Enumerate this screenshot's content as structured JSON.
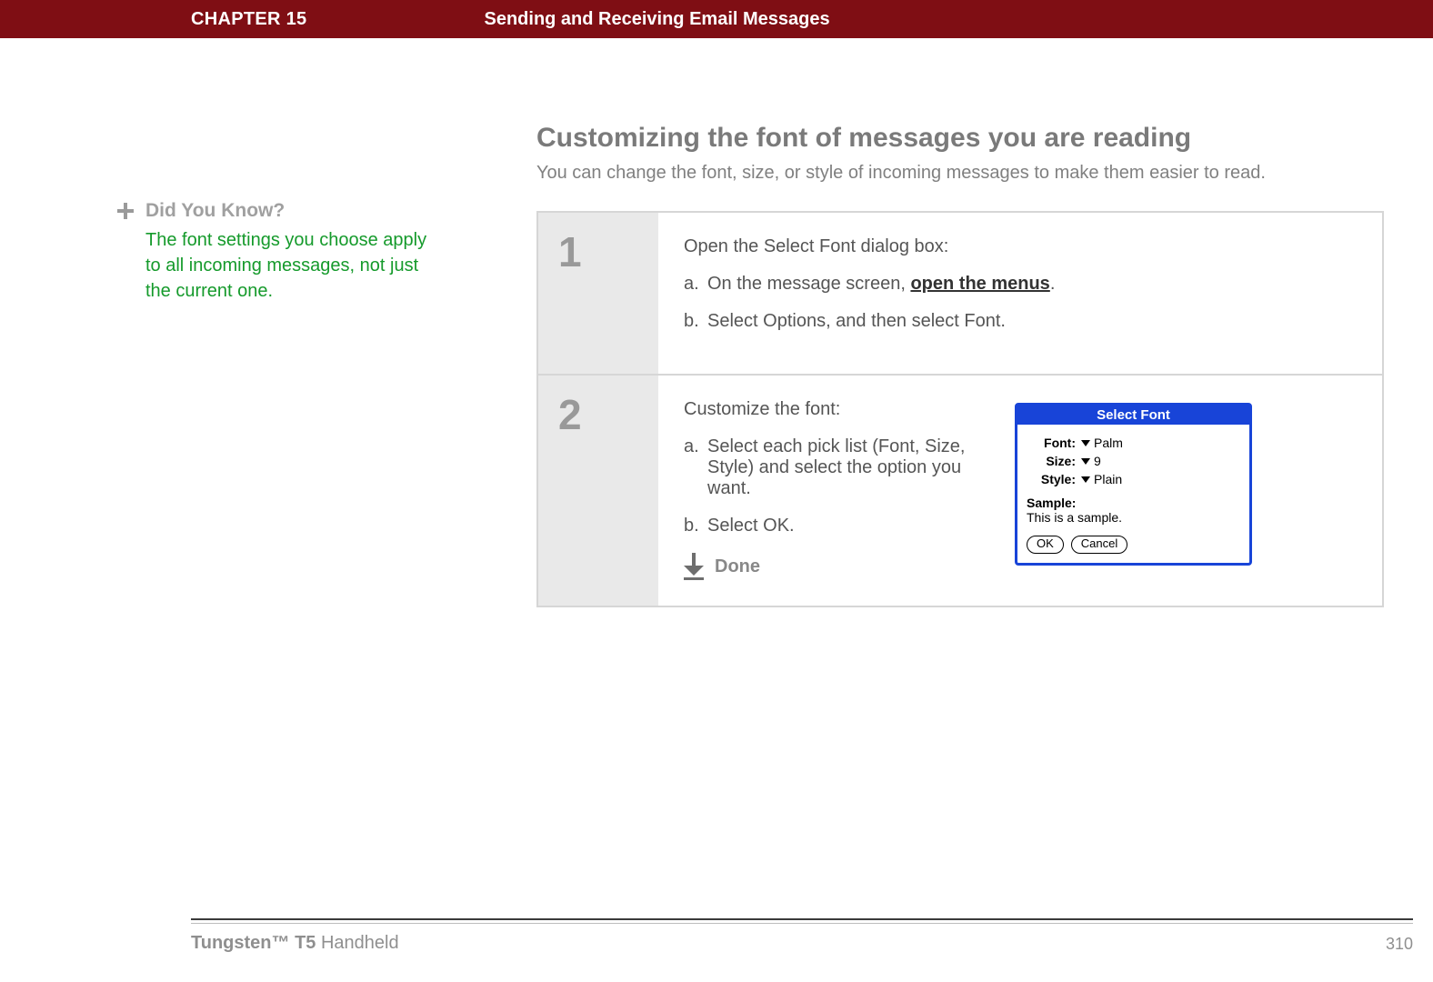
{
  "header": {
    "chapter": "CHAPTER 15",
    "title": "Sending and Receiving Email Messages"
  },
  "sidebar": {
    "did_you_know_label": "Did You Know?",
    "did_you_know_text": "The font settings you choose apply to all incoming messages, not just the current one."
  },
  "section": {
    "title": "Customizing the font of messages you are reading",
    "subtitle": "You can change the font, size, or style of incoming messages to make them easier to read."
  },
  "steps": [
    {
      "num": "1",
      "lead": "Open the Select Font dialog box:",
      "a_letter": "a.",
      "a_pre": "On the message screen, ",
      "a_link": "open the menus",
      "a_post": ".",
      "b_letter": "b.",
      "b_text": "Select Options, and then select Font."
    },
    {
      "num": "2",
      "lead": "Customize the font:",
      "a_letter": "a.",
      "a_text": "Select each pick list (Font, Size, Style) and select the option you want.",
      "b_letter": "b.",
      "b_text": "Select OK.",
      "done": "Done"
    }
  ],
  "dialog": {
    "title": "Select Font",
    "font_label": "Font:",
    "font_value": "Palm",
    "size_label": "Size:",
    "size_value": "9",
    "style_label": "Style:",
    "style_value": "Plain",
    "sample_label": "Sample:",
    "sample_text": "This is a sample.",
    "ok": "OK",
    "cancel": "Cancel"
  },
  "footer": {
    "product_bold": "Tungsten™ T5",
    "product_rest": " Handheld",
    "page": "310"
  }
}
